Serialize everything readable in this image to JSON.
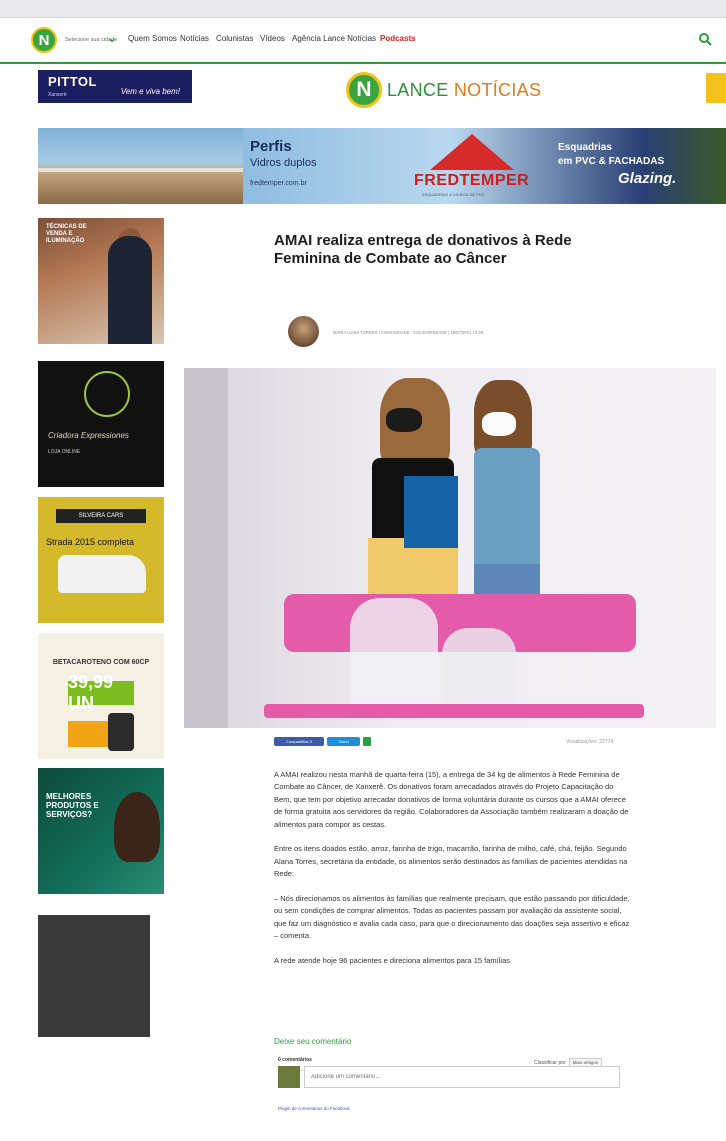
{
  "nav": {
    "logo_letter": "N",
    "city_select": "Selecione sua cidade",
    "items": [
      "Quem Somos",
      "Notícias",
      "Colunistas",
      "Vídeos",
      "Agência Lance Notícias"
    ],
    "podcasts": "Podcasts",
    "colors": {
      "green": "#2e9c3d",
      "podcasts": "#d61c1c"
    }
  },
  "header": {
    "logo_letter": "N",
    "logo_word_a": "LANCE",
    "logo_word_b": "NOTÍCIAS",
    "ad_pittol": {
      "brand": "PITTOL",
      "sub": "Xanxerê",
      "tag": "Vem e viva bem!"
    }
  },
  "banner_ad": {
    "perfis": "Perfis",
    "vidros": "Vidros duplos",
    "url": "fredtemper.com.br",
    "brand": "FREDTEMPER",
    "brand_sub": "ESQUADRIAS & VIDROS DE PVC",
    "esquadrias": "Esquadrias",
    "pvc": "em PVC & FACHADAS",
    "glazing": "Glazing."
  },
  "side_ads": {
    "ad1_title": "TÉCNICAS DE VENDA E ILUMINAÇÃO",
    "ad2_script": "Criadora Expressiones",
    "ad2_line": "LOJA ONLINE",
    "ad3_label": "SILVEIRA CARS",
    "ad3_text": "Strada 2015 completa",
    "ad4_title": "BETACAROTENO COM 60CP",
    "ad4_price": "39,99 UN",
    "ad5_title": "MELHORES PRODUTOS E SERVIÇOS?"
  },
  "article": {
    "title": "AMAI realiza entrega de donativos à Rede Feminina de Combate ao Câncer",
    "meta": "MARIA LUISA TORRES | COMUNIDADE , SOLIDARIEDADE | 15/07/2021 14:49",
    "share_fb": "Compartilhar 0",
    "share_tw": "Tweet",
    "views": "Visualizações: 22774",
    "paragraphs": [
      "A AMAI realizou nesta manhã de quarta-feira (15), a entrega de 34 kg de alimentos à Rede Feminina de Combate ao Câncer, de Xanxerê. Os donativos foram arrecadados através do Projeto Capacitação do Bem, que tem por objetivo arrecadar donativos de forma voluntária durante os cursos que a AMAI oferece de forma gratuita aos servidores da região. Colaboradores da Associação também realizaram a doação de alimentos para compor as cestas.",
      "Entre os itens doados estão, arroz, farinha de trigo, macarrão, farinha de milho, café, chá, feijão. Segundo Alana Torres, secretária da entidade, os alimentos serão destinados às famílias de pacientes atendidas na Rede:",
      "– Nós direcionamos os alimentos às famílias que realmente precisam, que estão passando por dificuldade, ou sem condições de comprar alimentos. Todas as pacientes passam por avaliação da assistente social, que faz um diagnóstico e avalia cada caso, para que o direcionamento das doações seja assertivo e eficaz – comenta.",
      "A rede atende hoje 96 pacientes e direciona alimentos para 15 famílias"
    ]
  },
  "comments": {
    "heading": "Deixe seu comentário",
    "count": "0 comentários",
    "sort_label": "Classificar por",
    "sort_value": "Mais antigos",
    "placeholder": "Adicione um comentário...",
    "plugin": "Plugin de comentários do Facebook"
  }
}
